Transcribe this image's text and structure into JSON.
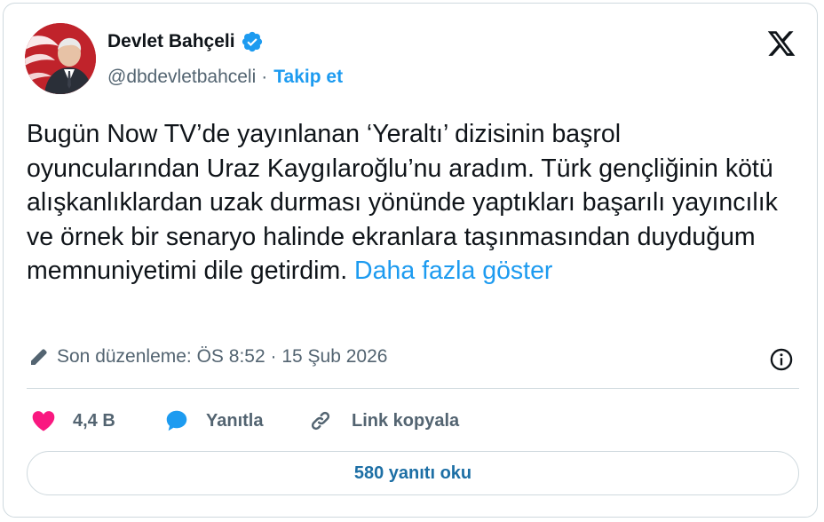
{
  "author": {
    "display_name": "Devlet Bahçeli",
    "handle": "@dbdevletbahceli",
    "separator": "·",
    "follow_label": "Takip et",
    "verified": true
  },
  "tweet": {
    "text": "Bugün Now TV’de yayınlanan ‘Yeraltı’ dizisinin başrol oyuncularından Uraz Kaygılaroğlu’nu aradım. Türk gençliğinin kötü alışkanlıklardan uzak durması yönünde yaptıkları başarılı yayıncılık ve örnek bir senaryo halinde ekranlara taşınmasından duyduğum memnuniyetimi dile getirdim.",
    "show_more_label": "Daha fazla göster"
  },
  "meta": {
    "edited_label": "Son düzenleme: ÖS 8:52 · 15 Şub 2026"
  },
  "actions": {
    "like_count": "4,4 B",
    "reply_label": "Yanıtla",
    "copy_link_label": "Link kopyala"
  },
  "footer": {
    "read_replies_label": "580 yanıtı oku"
  },
  "icons": {
    "brand_logo": "x-logo-icon",
    "verified": "verified-badge-icon",
    "edit": "pencil-icon",
    "info": "info-icon",
    "like": "heart-icon",
    "reply": "speech-bubble-icon",
    "copy": "link-icon"
  },
  "colors": {
    "accent": "#1d9bf0",
    "like": "#f91880",
    "text": "#0f1419",
    "muted": "#536471",
    "border": "#cfd9de"
  }
}
